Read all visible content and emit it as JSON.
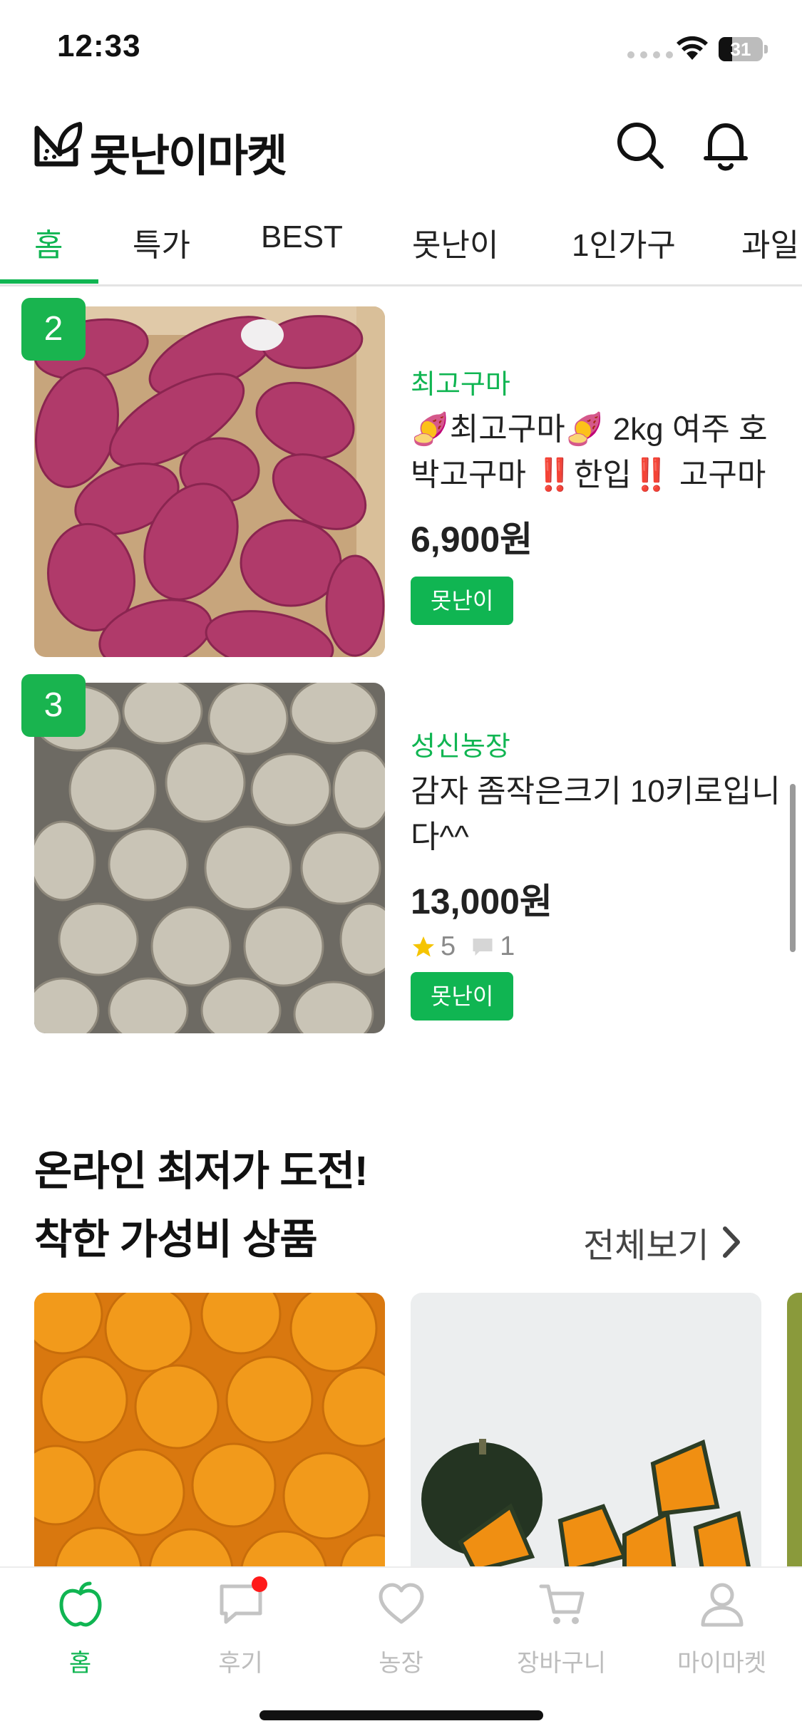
{
  "status_bar": {
    "time": "12:33",
    "battery": "31",
    "battery_level": 0.31
  },
  "header": {
    "app_name": "못난이마켓"
  },
  "tabs": [
    {
      "label": "홈",
      "active": true
    },
    {
      "label": "특가"
    },
    {
      "label": "BEST"
    },
    {
      "label": "못난이"
    },
    {
      "label": "1인가구"
    },
    {
      "label": "과일"
    }
  ],
  "products": [
    {
      "rank": "2",
      "farm": "최고구마",
      "name": "🍠최고구마🍠 2kg 여주 호박고구마 ‼️한입‼️ 고구마",
      "price": "6,900원",
      "tag": "못난이"
    },
    {
      "rank": "3",
      "farm": "성신농장",
      "name": "감자 좀작은크기 10키로입니다^^",
      "price": "13,000원",
      "rating": "5",
      "reviews": "1",
      "tag": "못난이"
    }
  ],
  "section": {
    "title_line1": "온라인 최저가 도전!",
    "title_line2": "착한 가성비 상품",
    "view_all": "전체보기"
  },
  "bottom_nav": [
    {
      "label": "홈",
      "icon": "apple-icon",
      "active": true
    },
    {
      "label": "후기",
      "icon": "chat-bubble-icon"
    },
    {
      "label": "농장",
      "icon": "heart-icon"
    },
    {
      "label": "장바구니",
      "icon": "cart-icon"
    },
    {
      "label": "마이마켓",
      "icon": "person-icon"
    }
  ],
  "colors": {
    "accent": "#10b552",
    "badge": "#19b44f",
    "notify": "#ff1a1a"
  }
}
